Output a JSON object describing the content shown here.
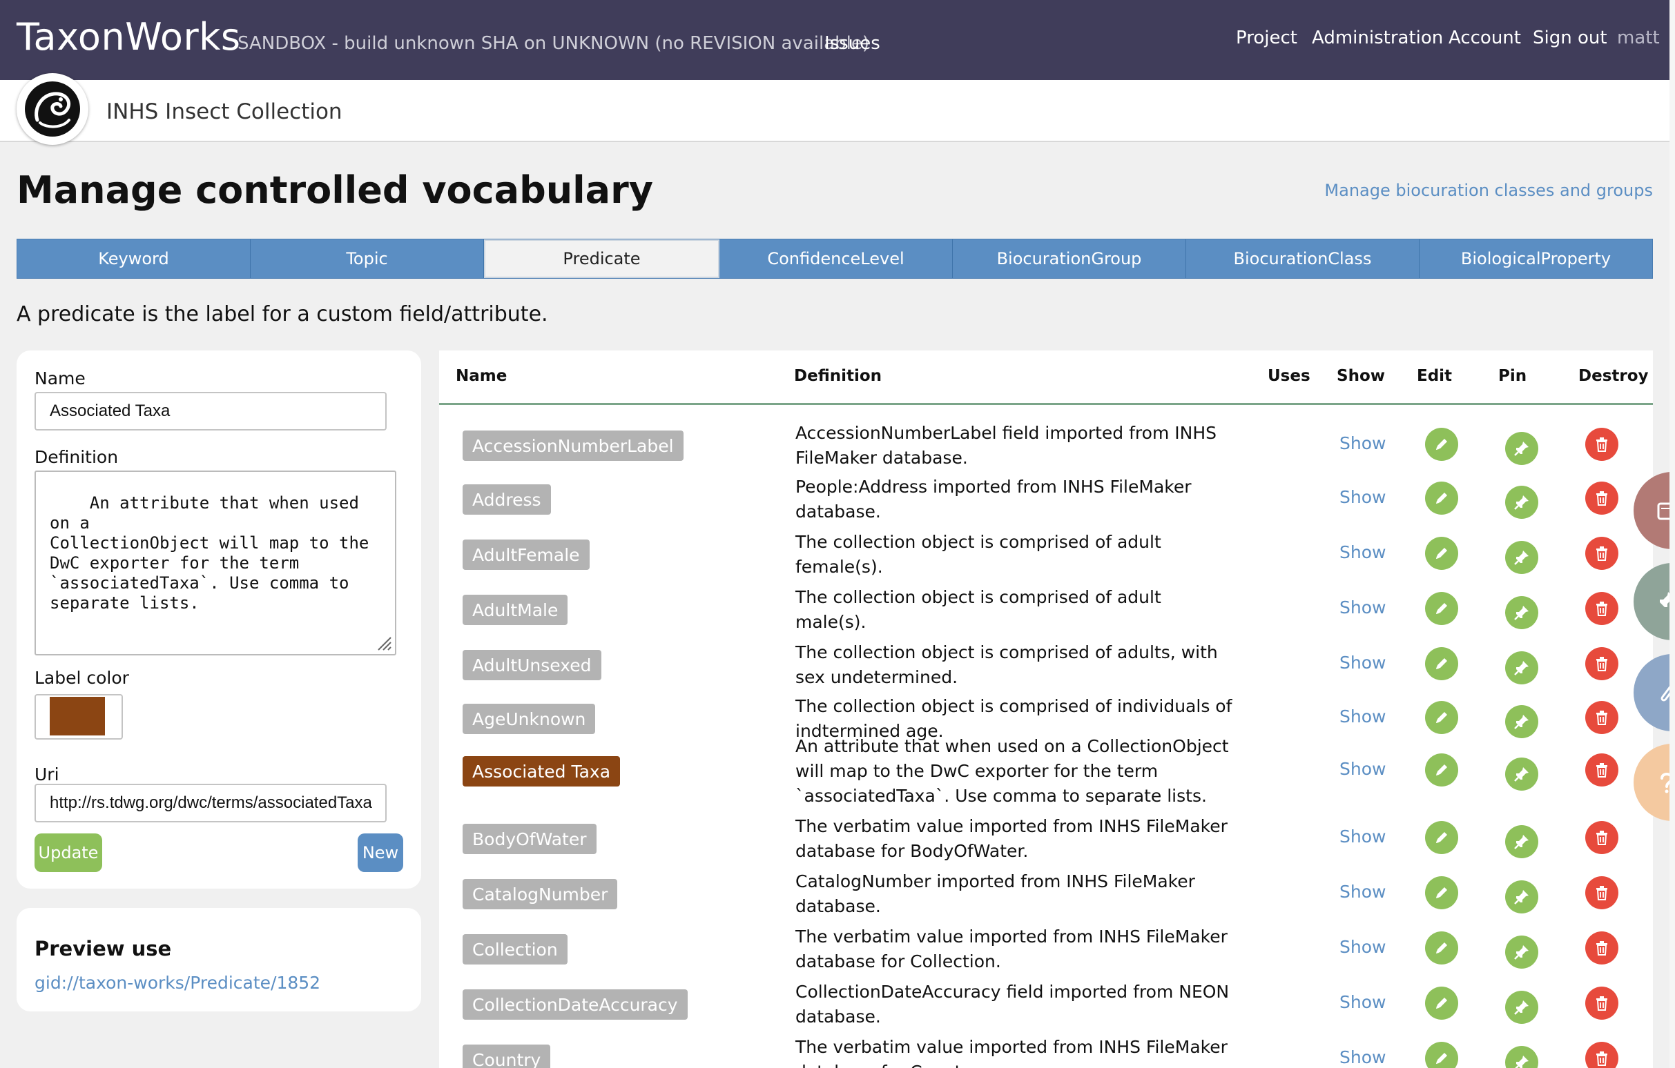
{
  "topbar": {
    "brand": "TaxonWorks",
    "sandbox": "SANDBOX - build unknown SHA on UNKNOWN (no REVISION available)",
    "issues": "Issues",
    "nav": {
      "project": "Project",
      "administration": "Administration",
      "account": "Account",
      "sign_out": "Sign out",
      "user": "matt"
    }
  },
  "project": {
    "name": "INHS Insect Collection"
  },
  "page": {
    "title": "Manage controlled vocabulary",
    "manage_link": "Manage biocuration classes and groups",
    "intro": "A predicate is the label for a custom field/attribute."
  },
  "tabs": [
    "Keyword",
    "Topic",
    "Predicate",
    "ConfidenceLevel",
    "BiocurationGroup",
    "BiocurationClass",
    "BiologicalProperty"
  ],
  "active_tab": "Predicate",
  "form": {
    "name_label": "Name",
    "name_value": "Associated Taxa",
    "definition_label": "Definition",
    "definition_value": "An attribute that when used on a\nCollectionObject will map to the\nDwC exporter for the term\n`associatedTaxa`. Use comma to\nseparate lists.",
    "color_label": "Label color",
    "color_value": "#8b4513",
    "uri_label": "Uri",
    "uri_value": "http://rs.tdwg.org/dwc/terms/associatedTaxa",
    "update_label": "Update",
    "new_label": "New"
  },
  "preview": {
    "title": "Preview use",
    "link": "gid://taxon-works/Predicate/1852"
  },
  "table": {
    "headers": {
      "name": "Name",
      "definition": "Definition",
      "uses": "Uses",
      "show": "Show",
      "edit": "Edit",
      "pin": "Pin",
      "destroy": "Destroy"
    },
    "show_label": "Show",
    "rows": [
      {
        "name": "AccessionNumberLabel",
        "definition": "AccessionNumberLabel field imported from INHS FileMaker database.",
        "color": "#b3b3b3"
      },
      {
        "name": "Address",
        "definition": "People:Address imported from INHS FileMaker database.",
        "color": "#b3b3b3"
      },
      {
        "name": "AdultFemale",
        "definition": "The collection object is comprised of adult female(s).",
        "color": "#b3b3b3"
      },
      {
        "name": "AdultMale",
        "definition": "The collection object is comprised of adult male(s).",
        "color": "#b3b3b3"
      },
      {
        "name": "AdultUnsexed",
        "definition": "The collection object is comprised of adults, with sex undetermined.",
        "color": "#b3b3b3"
      },
      {
        "name": "AgeUnknown",
        "definition": "The collection object is comprised of individuals of indtermined age.",
        "color": "#b3b3b3"
      },
      {
        "name": "Associated Taxa",
        "definition": "An attribute that when used on a CollectionObject will map to the DwC exporter for the term `associatedTaxa`. Use comma to separate lists.",
        "color": "#8b4513"
      },
      {
        "name": "BodyOfWater",
        "definition": "The verbatim value imported from INHS FileMaker database for BodyOfWater.",
        "color": "#b3b3b3"
      },
      {
        "name": "CatalogNumber",
        "definition": "CatalogNumber imported from INHS FileMaker database.",
        "color": "#b3b3b3"
      },
      {
        "name": "Collection",
        "definition": "The verbatim value imported from INHS FileMaker database for Collection.",
        "color": "#b3b3b3"
      },
      {
        "name": "CollectionDateAccuracy",
        "definition": "CollectionDateAccuracy field imported from NEON database.",
        "color": "#b3b3b3"
      },
      {
        "name": "Country",
        "definition": "The verbatim value imported from INHS FileMaker database for Country.",
        "color": "#b3b3b3"
      }
    ]
  },
  "colors": {
    "topbar": "#403d5a",
    "accent_blue": "#5b8ec3",
    "accent_green": "#8ec05a",
    "danger_red": "#e74a3c"
  },
  "side_widgets": [
    {
      "icon": "notepad-icon",
      "color": "#b27a75"
    },
    {
      "icon": "pin-icon",
      "color": "#8fa499"
    },
    {
      "icon": "clip-icon",
      "color": "#8ea7c7"
    },
    {
      "icon": "help-icon",
      "color": "#f4c9a0"
    }
  ]
}
